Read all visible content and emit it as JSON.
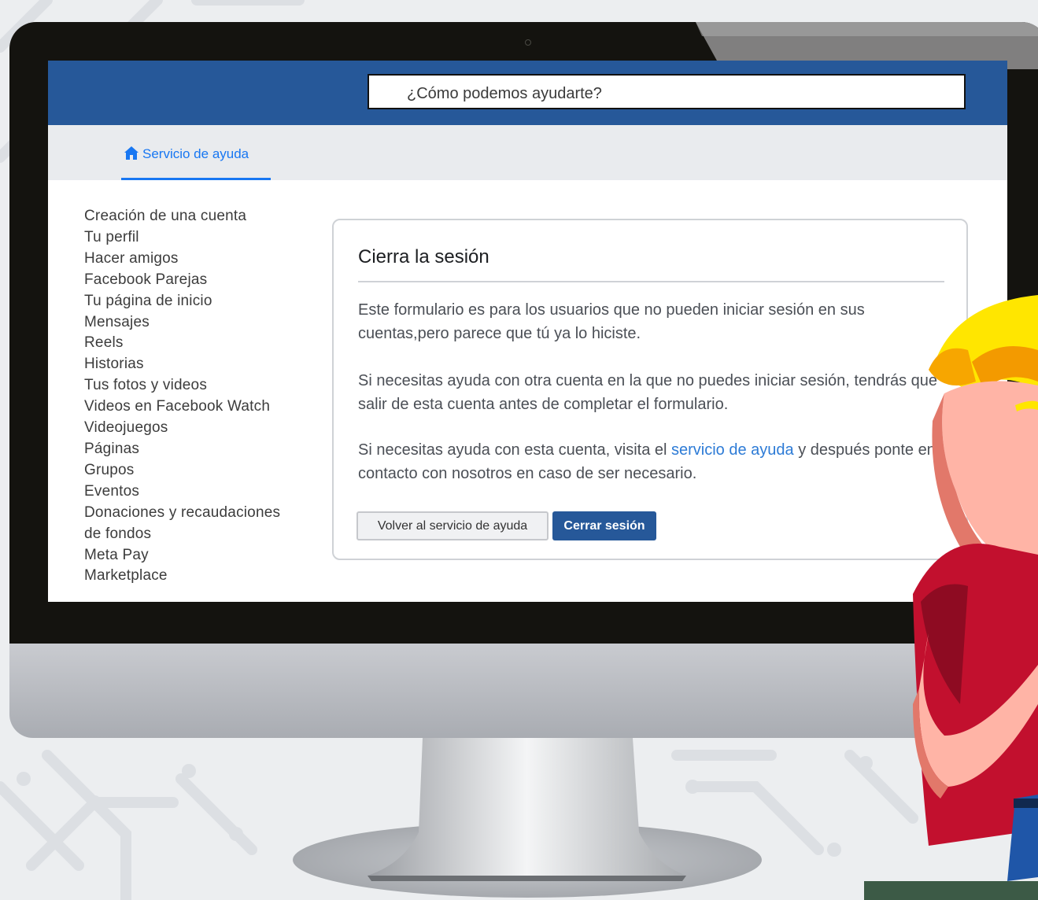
{
  "search": {
    "placeholder": "¿Cómo podemos ayudarte?"
  },
  "nav": {
    "home_tab": "Servicio de ayuda"
  },
  "sidebar": {
    "items": [
      "Creación de una cuenta",
      "Tu perfil",
      "Hacer amigos",
      "Facebook Parejas",
      "Tu página de inicio",
      "Mensajes",
      "Reels",
      "Historias",
      "Tus fotos y videos",
      "Videos en Facebook Watch",
      "Videojuegos",
      "Páginas",
      "Grupos",
      "Eventos",
      "Donaciones y recaudaciones",
      "de fondos",
      "Meta Pay",
      "Marketplace"
    ]
  },
  "card": {
    "title": "Cierra la sesión",
    "p1": "Este formulario es para los usuarios que no pueden iniciar sesión en sus cuentas,pero parece que tú ya lo hiciste.",
    "p2": "Si necesitas ayuda con otra cuenta en la que no puedes iniciar sesión, tendrás que salir de esta cuenta antes de completar el formulario.",
    "p3_before": "Si necesitas ayuda con esta cuenta, visita el ",
    "p3_link": "servicio de ayuda",
    "p3_after": " y después ponte en contacto con nosotros en caso de ser necesario.",
    "back_button": "Volver al servicio de ayuda",
    "logout_button": "Cerrar sesión"
  },
  "colors": {
    "header_blue": "#265899",
    "link_blue": "#1877f2",
    "subnav_gray": "#e9ebee"
  }
}
